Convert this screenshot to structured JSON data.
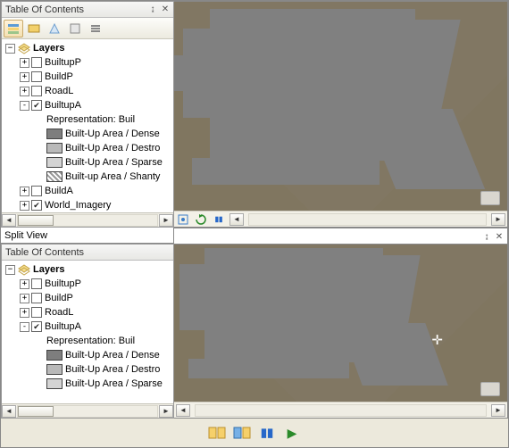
{
  "toc_top": {
    "title": "Table Of Contents",
    "layers_label": "Layers",
    "items": [
      {
        "label": "BuiltupP",
        "checked": false,
        "exp": "+"
      },
      {
        "label": "BuildP",
        "checked": false,
        "exp": "+"
      },
      {
        "label": "RoadL",
        "checked": false,
        "exp": "+"
      },
      {
        "label": "BuiltupA",
        "checked": true,
        "exp": "-"
      }
    ],
    "rep_label": "Representation: Buil",
    "rep_items": [
      {
        "label": "Built-Up Area / Dense",
        "swatch": "#7e7e7e"
      },
      {
        "label": "Built-Up Area / Destro",
        "swatch": "#b9b9b9"
      },
      {
        "label": "Built-Up Area / Sparse",
        "swatch": "#d4d4d4"
      },
      {
        "label": "Built-up Area / Shanty",
        "swatch": "pattern"
      }
    ],
    "tail": [
      {
        "label": "BuildA",
        "checked": false,
        "exp": "+"
      },
      {
        "label": "World_Imagery",
        "checked": true,
        "exp": "+"
      }
    ]
  },
  "split_label": "Split View",
  "toc_bot": {
    "title": "Table Of Contents",
    "layers_label": "Layers",
    "items": [
      {
        "label": "BuiltupP",
        "checked": false,
        "exp": "+"
      },
      {
        "label": "BuildP",
        "checked": false,
        "exp": "+"
      },
      {
        "label": "RoadL",
        "checked": false,
        "exp": "+"
      },
      {
        "label": "BuiltupA",
        "checked": true,
        "exp": "-"
      }
    ],
    "rep_label": "Representation: Buil",
    "rep_items": [
      {
        "label": "Built-Up Area / Dense",
        "swatch": "#7e7e7e"
      },
      {
        "label": "Built-Up Area / Destro",
        "swatch": "#b9b9b9"
      },
      {
        "label": "Built-Up Area / Sparse",
        "swatch": "#d4d4d4"
      }
    ]
  },
  "bottom_icons": [
    "split-icon",
    "sync-icon",
    "pause-icon",
    "play-icon"
  ]
}
